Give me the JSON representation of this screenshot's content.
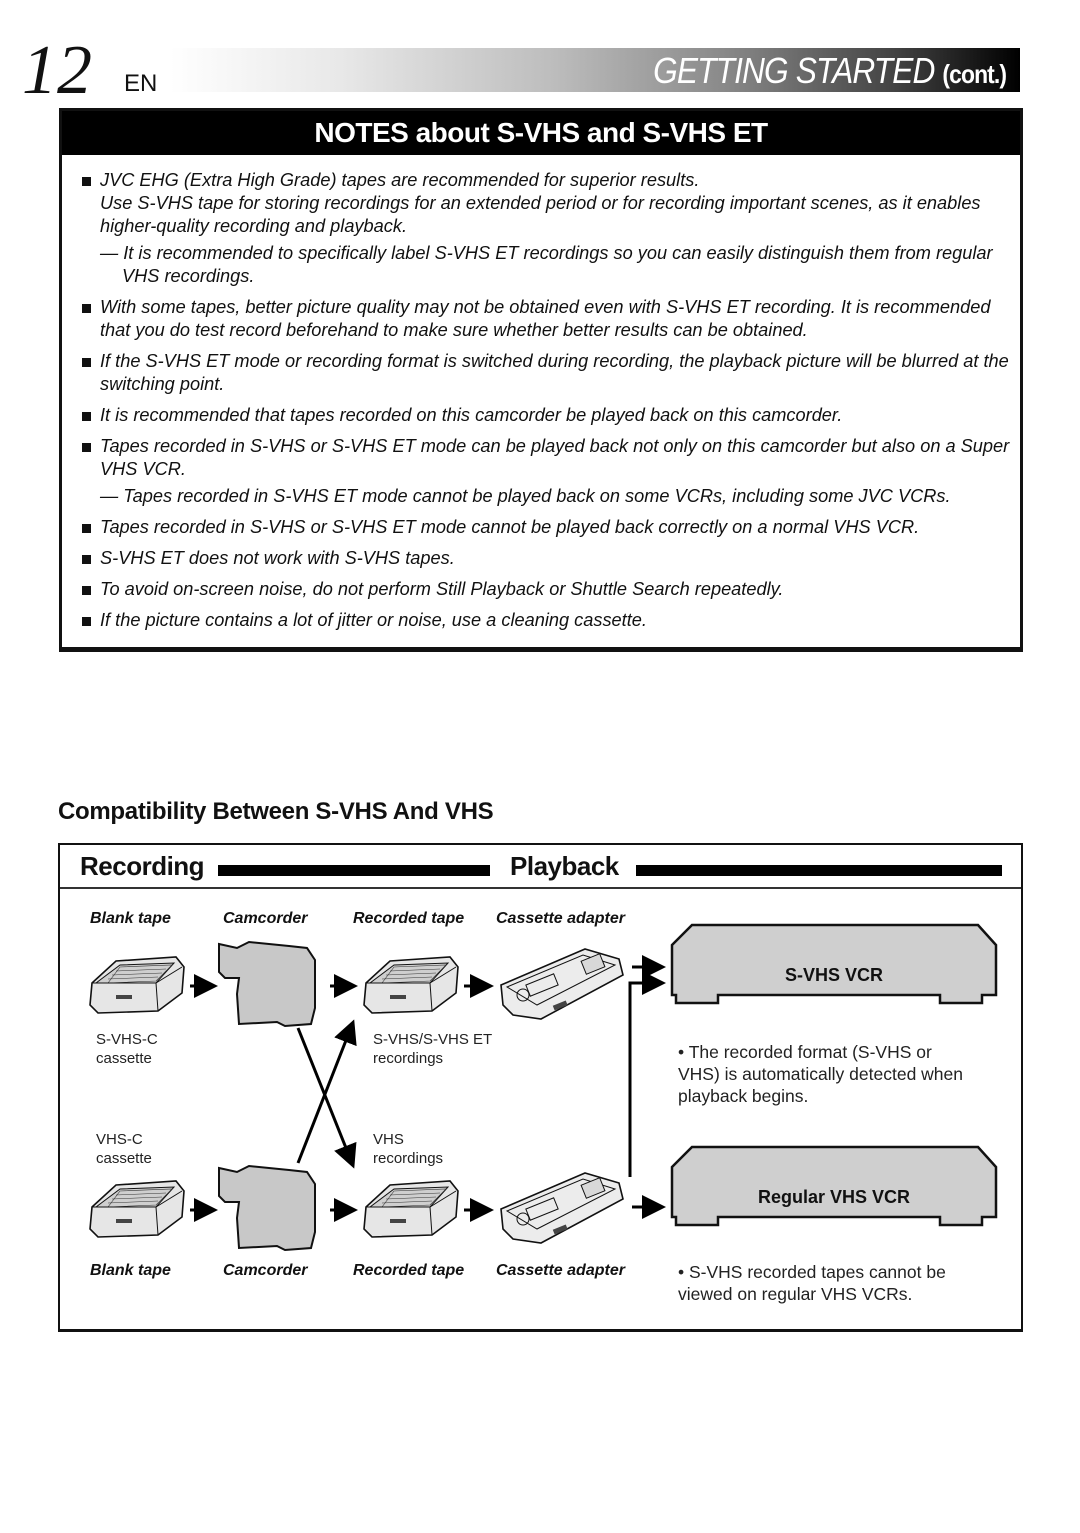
{
  "header": {
    "page_number": "12",
    "language": "EN",
    "section_title": "GETTING STARTED",
    "section_suffix": "(cont.)"
  },
  "notes": {
    "title": "NOTES about S-VHS and S-VHS ET",
    "items": [
      {
        "text": "JVC EHG (Extra High Grade) tapes are recommended for superior results.",
        "para": "Use S-VHS tape for storing recordings for an extended period or for recording important scenes, as it enables higher-quality recording and playback.",
        "sub": "— It is recommended to specifically label S-VHS ET recordings so you can easily distinguish them from regular VHS recordings."
      },
      {
        "text": "With some tapes, better picture quality may not be obtained even with S-VHS ET recording. It is recommended that you do test record beforehand to make sure whether better results can be obtained."
      },
      {
        "text": "If the S-VHS ET mode or recording format is switched during recording, the playback picture will be blurred at the switching point."
      },
      {
        "text": "It is recommended that tapes recorded on this camcorder be played back on this camcorder."
      },
      {
        "text": "Tapes recorded in S-VHS or S-VHS ET mode can be played back not only on this camcorder but also on a Super VHS VCR.",
        "sub": "— Tapes recorded in S-VHS ET mode cannot be played back on some VCRs, including some JVC VCRs."
      },
      {
        "text": "Tapes recorded in S-VHS or S-VHS ET mode cannot be played back correctly on a normal VHS VCR."
      },
      {
        "text": "S-VHS ET does not work with S-VHS tapes."
      },
      {
        "text": "To avoid on-screen noise, do not perform Still Playback or Shuttle Search repeatedly."
      },
      {
        "text": "If the picture contains a lot of jitter or noise, use a cleaning cassette."
      }
    ]
  },
  "compatibility": {
    "title": "Compatibility Between S-VHS And VHS",
    "recording_label": "Recording",
    "playback_label": "Playback",
    "column_labels": [
      "Blank tape",
      "Camcorder",
      "Recorded tape",
      "Cassette adapter"
    ],
    "top_row": {
      "cassette_label_line1": "S-VHS-C",
      "cassette_label_line2": "cassette",
      "recordings_label_line1": "S-VHS/S-VHS ET",
      "recordings_label_line2": "recordings"
    },
    "bottom_row": {
      "cassette_label_line1": "VHS-C",
      "cassette_label_line2": "cassette",
      "recordings_label_line1": "VHS",
      "recordings_label_line2": "recordings"
    },
    "svhs_vcr": {
      "label": "S-VHS VCR",
      "note": "The recorded format (S-VHS or VHS) is automatically detected when playback begins."
    },
    "regular_vcr": {
      "label": "Regular VHS VCR",
      "note": "S-VHS recorded tapes cannot be viewed on regular VHS VCRs."
    }
  }
}
